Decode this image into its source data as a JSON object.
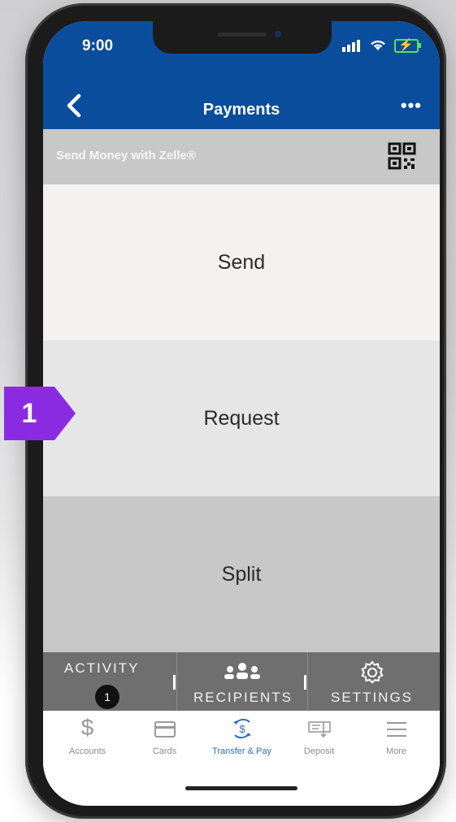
{
  "status_bar": {
    "time": "9:00",
    "battery_color": "#5ce25a"
  },
  "header": {
    "title": "Payments",
    "back_icon": "chevron-left-icon",
    "more_icon": "more-horizontal-icon",
    "more_glyph": "•••",
    "background": "#0a4d9c"
  },
  "zelle": {
    "label": "Send Money with Zelle®",
    "qr_icon": "qr-code-icon"
  },
  "actions": [
    {
      "label": "Send"
    },
    {
      "label": "Request"
    },
    {
      "label": "Split"
    }
  ],
  "tabs": {
    "activity": {
      "label": "ACTIVITY",
      "badge": "1"
    },
    "recipients": {
      "label": "RECIPIENTS",
      "icon": "people-icon"
    },
    "settings": {
      "label": "SETTINGS",
      "icon": "gear-icon"
    }
  },
  "bottom_nav": [
    {
      "label": "Accounts",
      "icon": "dollar-icon",
      "glyph": "$"
    },
    {
      "label": "Cards",
      "icon": "card-icon"
    },
    {
      "label": "Transfer & Pay",
      "icon": "transfer-pay-icon",
      "active": true
    },
    {
      "label": "Deposit",
      "icon": "check-deposit-icon"
    },
    {
      "label": "More",
      "icon": "menu-icon"
    }
  ],
  "annotation": {
    "step": "1",
    "color": "#8a2be2"
  },
  "colors": {
    "accent": "#2f6fb6",
    "tabstrip": "#6f6f6f"
  }
}
